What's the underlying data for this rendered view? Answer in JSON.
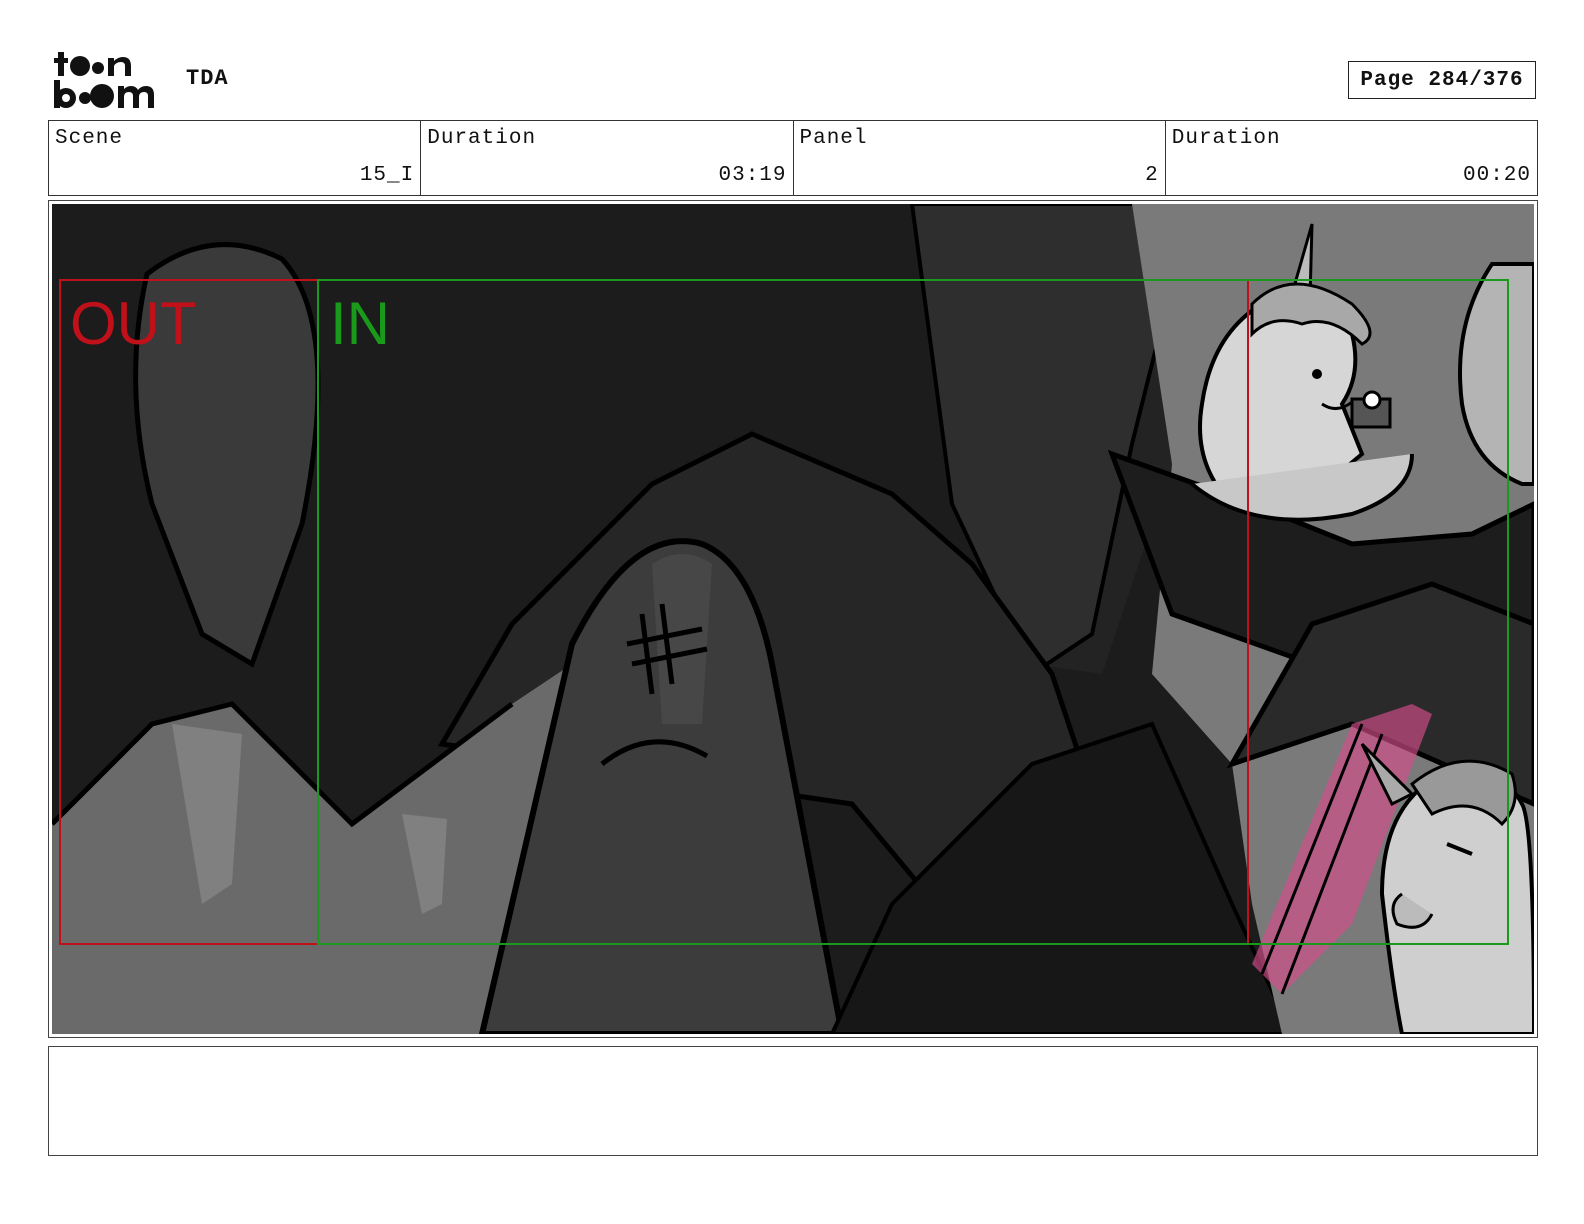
{
  "header": {
    "logo_text": "toon boom",
    "project": "TDA",
    "page_label": "Page 284/376"
  },
  "info": [
    {
      "label": "Scene",
      "value": "15_I"
    },
    {
      "label": "Duration",
      "value": "03:19"
    },
    {
      "label": "Panel",
      "value": "2"
    },
    {
      "label": "Duration",
      "value": "00:20"
    }
  ],
  "panel": {
    "out_label": "OUT",
    "in_label": "IN",
    "out_color": "#c0101a",
    "in_color": "#1a9a1a",
    "accent_pink": "#d64f8c"
  },
  "notes": {
    "text": ""
  }
}
